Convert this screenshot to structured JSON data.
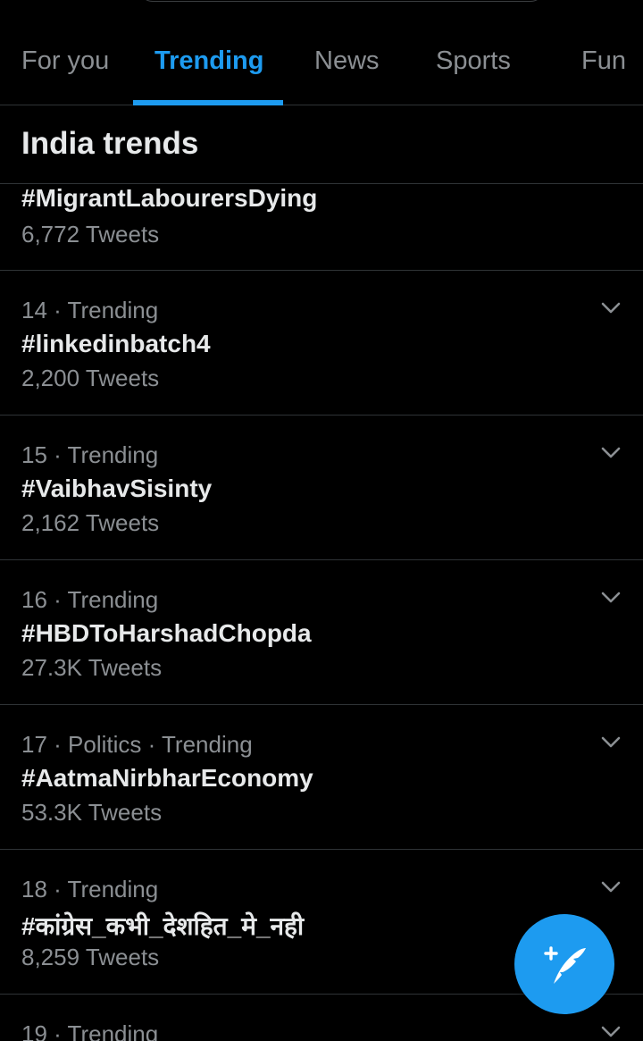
{
  "tabs": [
    {
      "label": "For you"
    },
    {
      "label": "Trending"
    },
    {
      "label": "News"
    },
    {
      "label": "Sports"
    },
    {
      "label": "Fun"
    }
  ],
  "active_tab": "Trending",
  "section": {
    "title": "India trends"
  },
  "trends": [
    {
      "meta": "",
      "name": "#MigrantLabourersDying",
      "count": "6,772 Tweets"
    },
    {
      "meta": "14 · Trending",
      "name": "#linkedinbatch4",
      "count": "2,200 Tweets"
    },
    {
      "meta": "15 · Trending",
      "name": "#VaibhavSisinty",
      "count": "2,162 Tweets"
    },
    {
      "meta": "16 · Trending",
      "name": "#HBDToHarshadChopda",
      "count": "27.3K Tweets"
    },
    {
      "meta": "17 · Politics · Trending",
      "name": "#AatmaNirbharEconomy",
      "count": "53.3K Tweets"
    },
    {
      "meta": "18 · Trending",
      "name": "#कांग्रेस_कभी_देशहित_मे_नही",
      "count": "8,259 Tweets"
    },
    {
      "meta": "19 · Trending",
      "name": "",
      "count": ""
    }
  ],
  "icons": {
    "chevron": "chevron-down-icon",
    "compose": "compose-tweet-icon"
  },
  "colors": {
    "accent": "#1d9bf0",
    "background": "#000000",
    "divider": "#2f3336",
    "secondary_text": "#8b8f93"
  }
}
